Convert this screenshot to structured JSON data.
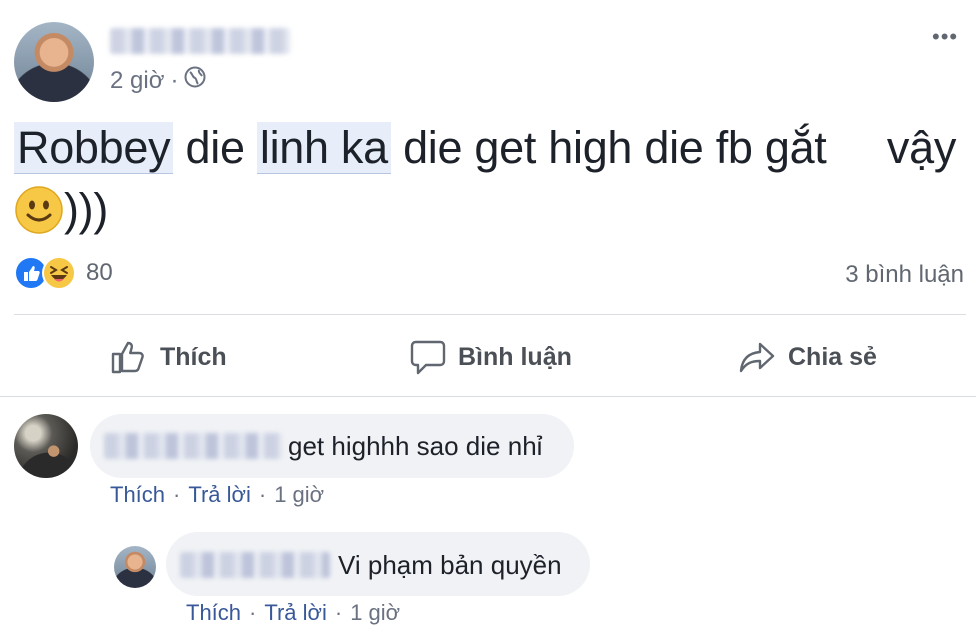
{
  "post": {
    "time": "2 giờ",
    "separator": "·",
    "body_parts": [
      "Robbey",
      "die",
      "linh ka",
      "die get high die fb gắt",
      "vậy"
    ],
    "body_tail": ")))",
    "reaction_count": "80",
    "comment_count": "3 bình luận",
    "more_label": "•••",
    "author_name_redacted": true
  },
  "actions": {
    "like": "Thích",
    "comment": "Bình luận",
    "share": "Chia sẻ"
  },
  "comments": [
    {
      "text": "get highhh sao die nhỉ",
      "like": "Thích",
      "dot": "·",
      "reply": "Trả lời",
      "time": "1 giờ"
    },
    {
      "text": "Vi phạm bản quyền",
      "like": "Thích",
      "dot": "·",
      "reply": "Trả lời",
      "time": "1 giờ"
    }
  ],
  "colors": {
    "link": "#385898",
    "like_blue": "#2078f4",
    "haha_yellow": "#f7c845",
    "divider": "#dadde1"
  },
  "icons": [
    "globe-icon",
    "like-reaction-icon",
    "haha-reaction-icon",
    "thumbs-up-icon",
    "comment-icon",
    "share-icon",
    "smile-emoji-icon",
    "more-icon"
  ]
}
